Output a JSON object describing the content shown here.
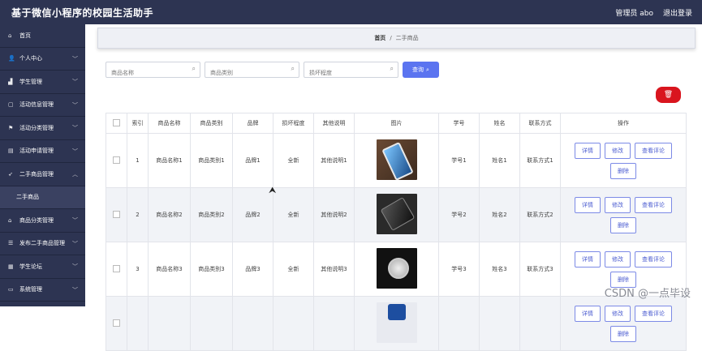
{
  "header": {
    "title": "基于微信小程序的校园生活助手",
    "user": "管理员 abo",
    "logout": "退出登录"
  },
  "sidebar": {
    "items": [
      {
        "label": "首页",
        "icon": "home-icon",
        "glyph": "⌂",
        "chevron": false
      },
      {
        "label": "个人中心",
        "icon": "user-icon",
        "glyph": "👤",
        "chevron": true
      },
      {
        "label": "学生管理",
        "icon": "chart-icon",
        "glyph": "▟",
        "chevron": true
      },
      {
        "label": "活动信息管理",
        "icon": "image-icon",
        "glyph": "▢",
        "chevron": true
      },
      {
        "label": "活动分类管理",
        "icon": "flag-icon",
        "glyph": "⚑",
        "chevron": true
      },
      {
        "label": "活动申请管理",
        "icon": "doc-icon",
        "glyph": "▤",
        "chevron": true
      },
      {
        "label": "二手商品管理",
        "icon": "send-icon",
        "glyph": "➶",
        "chevron": true,
        "open": true
      },
      {
        "label": "二手商品",
        "sub": true
      },
      {
        "label": "商品分类管理",
        "icon": "bank-icon",
        "glyph": "⌂",
        "chevron": true
      },
      {
        "label": "发布二手商品管理",
        "icon": "list-icon",
        "glyph": "☰",
        "chevron": true
      },
      {
        "label": "学生论坛",
        "icon": "forum-icon",
        "glyph": "▦",
        "chevron": true
      },
      {
        "label": "系统管理",
        "icon": "settings-icon",
        "glyph": "▭",
        "chevron": true
      }
    ]
  },
  "breadcrumb": {
    "home": "首页",
    "sep": "/",
    "current": "二手商品"
  },
  "search": {
    "name_placeholder": "商品名称",
    "category_placeholder": "商品类别",
    "condition_placeholder": "损坏程度",
    "query_label": "查询"
  },
  "table": {
    "headers": [
      "",
      "索引",
      "商品名称",
      "商品类别",
      "品牌",
      "损坏程度",
      "其他说明",
      "图片",
      "学号",
      "姓名",
      "联系方式",
      "操作"
    ],
    "rows": [
      {
        "index": "1",
        "name": "商品名称1",
        "category": "商品类别1",
        "brand": "品牌1",
        "condition": "全新",
        "note": "其他说明1",
        "student_no": "学号1",
        "student_name": "姓名1",
        "contact": "联系方式1"
      },
      {
        "index": "2",
        "name": "商品名称2",
        "category": "商品类别2",
        "brand": "品牌2",
        "condition": "全新",
        "note": "其他说明2",
        "student_no": "学号2",
        "student_name": "姓名2",
        "contact": "联系方式2"
      },
      {
        "index": "3",
        "name": "商品名称3",
        "category": "商品类别3",
        "brand": "品牌3",
        "condition": "全新",
        "note": "其他说明3",
        "student_no": "学号3",
        "student_name": "姓名3",
        "contact": "联系方式3"
      },
      {
        "index": "",
        "name": "",
        "category": "",
        "brand": "",
        "condition": "",
        "note": "",
        "student_no": "",
        "student_name": "",
        "contact": ""
      }
    ],
    "actions": {
      "detail": "详情",
      "edit": "修改",
      "review": "查看评论",
      "delete": "删除"
    }
  },
  "watermark": "CSDN @一点毕设",
  "colors": {
    "sidebar": "#2d3452",
    "accent": "#5b74f0",
    "danger": "#d9151e"
  }
}
